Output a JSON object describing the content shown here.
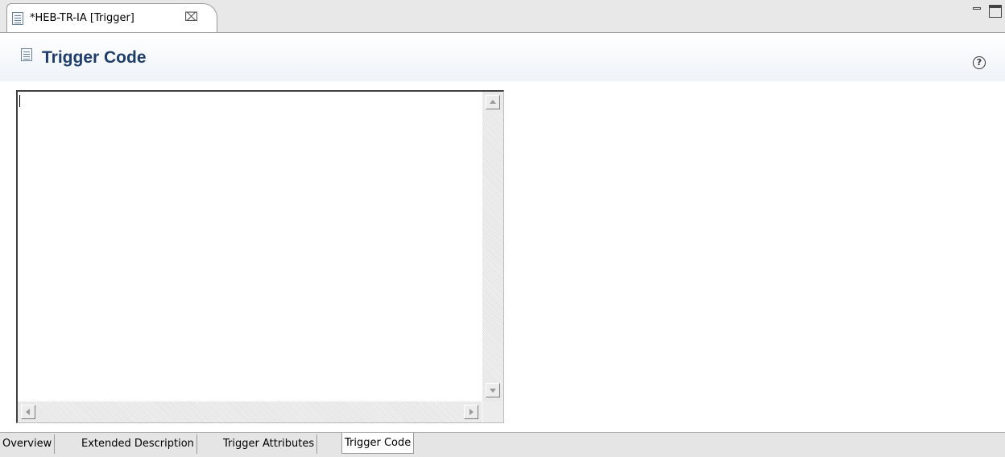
{
  "editor_tab": {
    "label": "*HEB-TR-IA [Trigger]",
    "close_glyph": "⌧"
  },
  "form": {
    "title": "Trigger Code",
    "help_glyph": "?"
  },
  "code_area": {
    "value": ""
  },
  "page_tabs": [
    {
      "label": "Overview"
    },
    {
      "label": "Extended Description"
    },
    {
      "label": "Trigger Attributes"
    },
    {
      "label": "Trigger Code",
      "active": true
    }
  ],
  "colors": {
    "title": "#1f3d6b",
    "header_gradient_end": "#eef3f8",
    "tabbar": "#e8e8e8"
  },
  "icons": [
    "document-icon",
    "close-icon",
    "minimize-icon",
    "maximize-icon",
    "help-icon"
  ]
}
